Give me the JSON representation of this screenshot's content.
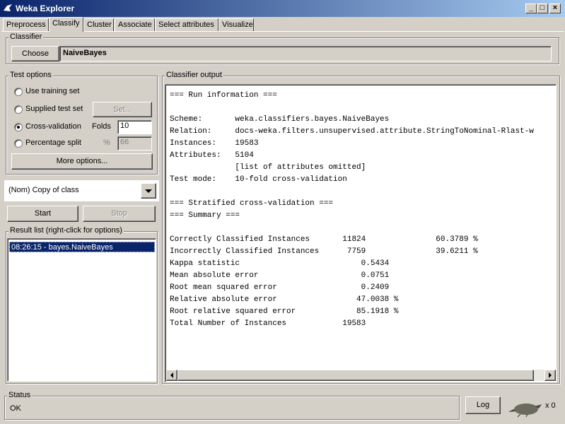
{
  "window": {
    "title": "Weka Explorer"
  },
  "tabs": [
    "Preprocess",
    "Classify",
    "Cluster",
    "Associate",
    "Select attributes",
    "Visualize"
  ],
  "classifier": {
    "section_label": "Classifier",
    "choose_label": "Choose",
    "name": "NaiveBayes"
  },
  "test_options": {
    "section_label": "Test options",
    "use_training_set": "Use training set",
    "supplied_test_set": "Supplied test set",
    "set_button": "Set...",
    "cross_validation": "Cross-validation",
    "folds_label": "Folds",
    "folds_value": "10",
    "percentage_split": "Percentage split",
    "percent_symbol": "%",
    "percent_value": "66",
    "more_options": "More options...",
    "selected": "cross-validation"
  },
  "class_select": {
    "value": "(Nom) Copy of class"
  },
  "run_buttons": {
    "start": "Start",
    "stop": "Stop"
  },
  "result_list": {
    "section_label": "Result list (right-click for options)",
    "items": [
      "08:26:15 - bayes.NaiveBayes"
    ]
  },
  "output": {
    "section_label": "Classifier output",
    "lines": [
      "=== Run information ===",
      "",
      "Scheme:       weka.classifiers.bayes.NaiveBayes",
      "Relation:     docs-weka.filters.unsupervised.attribute.StringToNominal-Rlast-w",
      "Instances:    19583",
      "Attributes:   5104",
      "              [list of attributes omitted]",
      "Test mode:    10-fold cross-validation",
      "",
      "=== Stratified cross-validation ===",
      "=== Summary ===",
      "",
      "Correctly Classified Instances       11824               60.3789 %",
      "Incorrectly Classified Instances      7759               39.6211 %",
      "Kappa statistic                          0.5434",
      "Mean absolute error                      0.0751",
      "Root mean squared error                  0.2409",
      "Relative absolute error                 47.0038 %",
      "Root relative squared error             85.1918 %",
      "Total Number of Instances            19583"
    ]
  },
  "status": {
    "section_label": "Status",
    "text": "OK",
    "log_label": "Log",
    "count": "x 0"
  }
}
